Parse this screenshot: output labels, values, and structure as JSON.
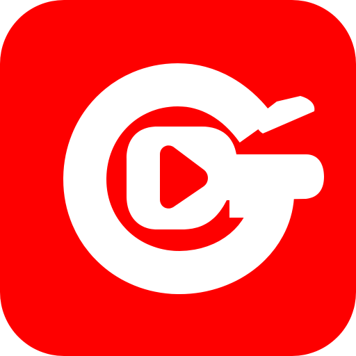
{
  "icon": {
    "name": "video-replay-app-icon",
    "glyph": "play-icon",
    "colors": {
      "background": "#fe0000",
      "foreground": "#ffffff",
      "canvas": "#ffffff"
    }
  }
}
